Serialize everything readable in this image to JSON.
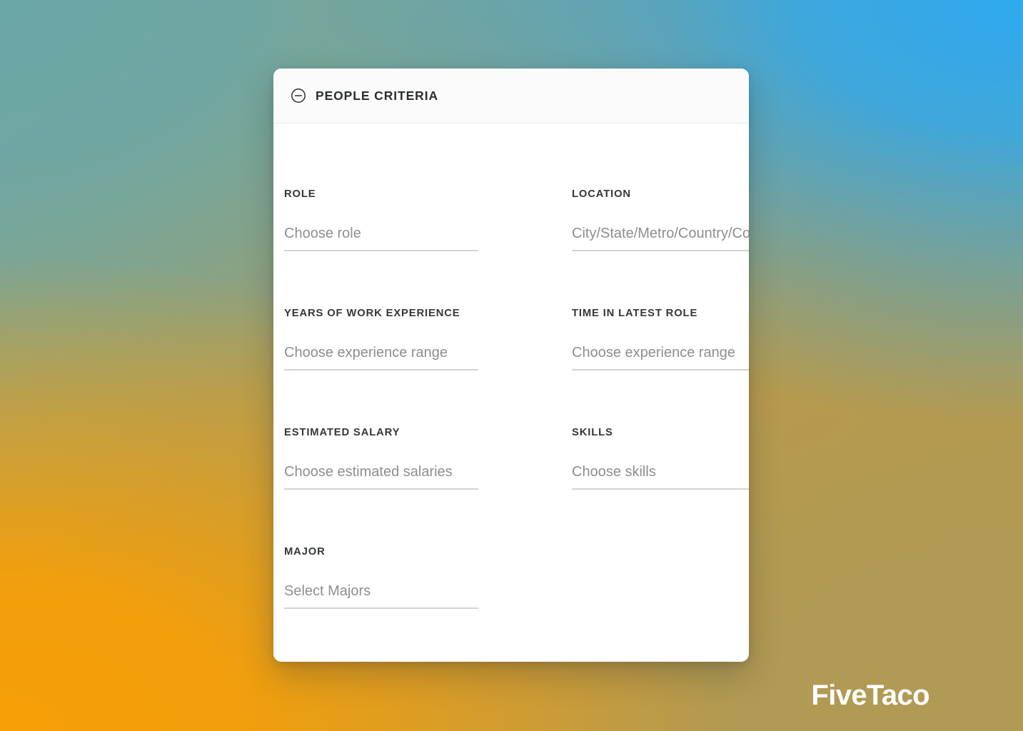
{
  "card": {
    "header": {
      "title": "PEOPLE CRITERIA",
      "collapse_icon": "circle-minus-icon"
    },
    "fields": [
      {
        "label": "ROLE",
        "placeholder": "Choose role"
      },
      {
        "label": "LOCATION",
        "placeholder": "City/State/Metro/Country/Continent"
      },
      {
        "label": "YEARS OF WORK EXPERIENCE",
        "placeholder": "Choose experience range"
      },
      {
        "label": "TIME IN LATEST ROLE",
        "placeholder": "Choose experience range"
      },
      {
        "label": "ESTIMATED SALARY",
        "placeholder": "Choose estimated salaries"
      },
      {
        "label": "SKILLS",
        "placeholder": "Choose skills"
      },
      {
        "label": "MAJOR",
        "placeholder": "Select Majors"
      }
    ]
  },
  "watermark": {
    "text": "FiveTaco"
  },
  "colors": {
    "card_background": "#ffffff",
    "header_background": "#fbfbfb",
    "label_text": "#33373b",
    "placeholder_text": "#8e8e8e",
    "underline": "#d3d3d3",
    "backdrop_top_left": "#6ba7a6",
    "backdrop_top_right": "#2ea9ef",
    "backdrop_bottom_left": "#f79f06",
    "backdrop_bottom_right": "#b09a54",
    "watermark_text": "#ffffff"
  }
}
